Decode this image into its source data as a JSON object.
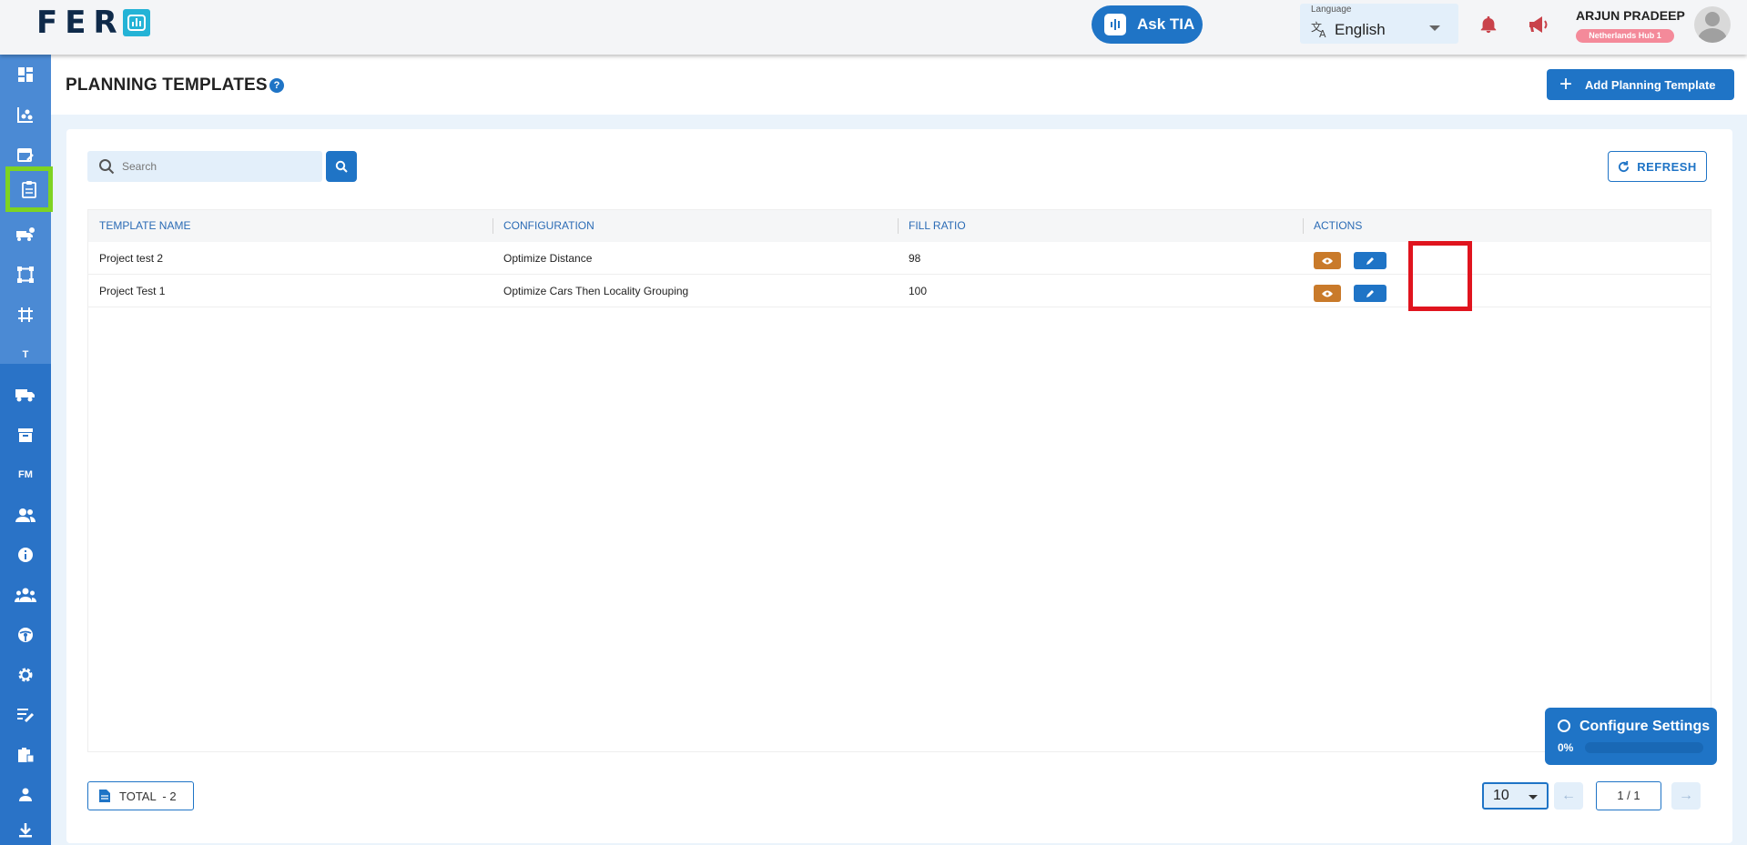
{
  "app": {
    "logo_text": "FER"
  },
  "header": {
    "ask_tia_label": "Ask TIA",
    "language": {
      "label": "Language",
      "value": "English"
    },
    "user": {
      "name": "ARJUN PRADEEP",
      "hub": "Netherlands Hub 1"
    }
  },
  "sidebar": {
    "items": [
      {
        "name": "dashboard-icon"
      },
      {
        "name": "analytics-icon"
      },
      {
        "name": "calendar-edit-icon"
      },
      {
        "name": "clipboard-icon",
        "active": true
      },
      {
        "name": "vehicle-settings-icon"
      },
      {
        "name": "network-icon"
      },
      {
        "name": "grid-hash-icon"
      },
      {
        "name": "text-t-icon",
        "text": "T"
      },
      {
        "name": "truck-icon"
      },
      {
        "name": "archive-icon"
      },
      {
        "name": "fm-icon",
        "text": "FM"
      },
      {
        "name": "users-icon"
      },
      {
        "name": "info-icon"
      },
      {
        "name": "groups-icon"
      },
      {
        "name": "steering-wheel-icon"
      },
      {
        "name": "settings-icon"
      },
      {
        "name": "note-edit-icon"
      },
      {
        "name": "inventory-icon"
      },
      {
        "name": "person-pin-icon"
      },
      {
        "name": "download-icon"
      }
    ]
  },
  "page": {
    "title": "PLANNING TEMPLATES",
    "help_label": "?",
    "add_button_label": "Add Planning Template"
  },
  "toolbar": {
    "search_placeholder": "Search",
    "refresh_label": "REFRESH"
  },
  "table": {
    "columns": [
      "TEMPLATE NAME",
      "CONFIGURATION",
      "FILL RATIO",
      "ACTIONS"
    ],
    "rows": [
      {
        "template_name": "Project test 2",
        "configuration": "Optimize Distance",
        "fill_ratio": "98"
      },
      {
        "template_name": "Project Test 1",
        "configuration": "Optimize Cars Then Locality Grouping",
        "fill_ratio": "100"
      }
    ]
  },
  "footer": {
    "total_label": "TOTAL  - 2",
    "per_page": "10",
    "page_info": "1 / 1"
  },
  "config_widget": {
    "title": "Configure Settings",
    "progress_label": "0%",
    "progress": 0
  },
  "colors": {
    "primary": "#1f74c6",
    "view_action": "#c97a2a",
    "highlight": "#e0141e",
    "active_nav": "#7ed321"
  }
}
